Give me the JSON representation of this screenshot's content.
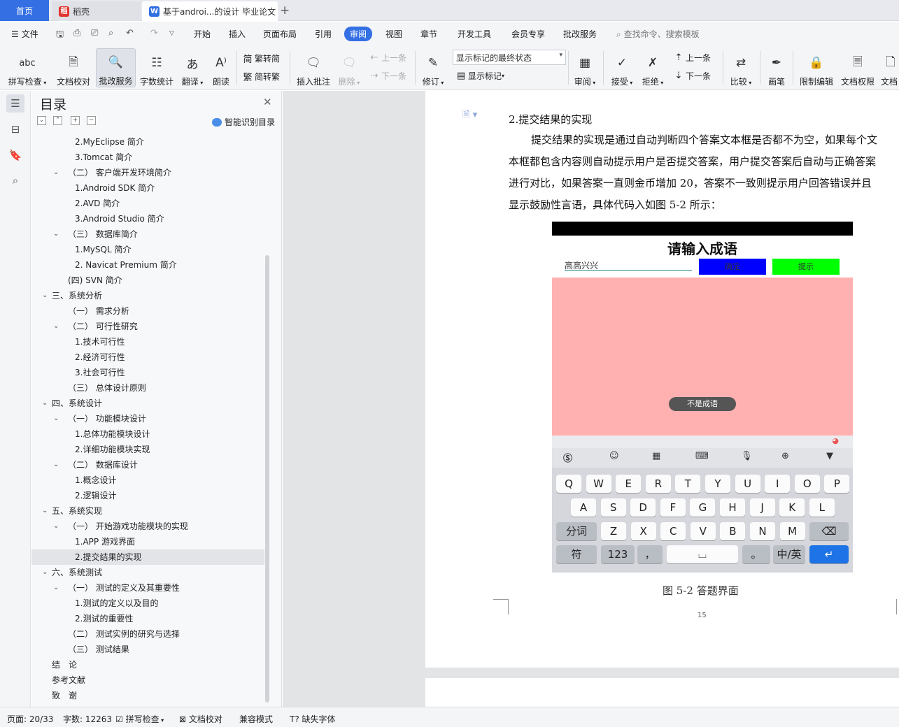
{
  "tabs": {
    "home": "首页",
    "daoke": "稻壳",
    "document": "基于androi...的设计 毕业论文"
  },
  "menu": {
    "file": "文件",
    "items": [
      "开始",
      "插入",
      "页面布局",
      "引用",
      "审阅",
      "视图",
      "章节",
      "开发工具",
      "会员专享",
      "批改服务"
    ],
    "active": "审阅",
    "search_placeholder": "查找命令、搜索模板"
  },
  "ribbon": {
    "spell_check": "拼写检查",
    "doc_check": "文档校对",
    "review_service": "批改服务",
    "word_count": "字数统计",
    "translate": "翻译",
    "read_aloud": "朗读",
    "trad_conv": "繁转简",
    "simp_conv": "简转繁",
    "insert_comment": "插入批注",
    "delete": "删除",
    "prev": "上一条",
    "next": "下一条",
    "track_changes": "修订",
    "markup_state": "显示标记的最终状态",
    "show_markup": "显示标记",
    "review": "审阅",
    "accept": "接受",
    "reject": "拒绝",
    "prev2": "上一条",
    "next2": "下一条",
    "compare": "比较",
    "pen": "画笔",
    "restrict_edit": "限制编辑",
    "doc_permission": "文档权限",
    "doc_more": "文档"
  },
  "toc": {
    "title": "目录",
    "smart": "智能识别目录",
    "items": [
      {
        "label": "2.MyEclipse 简介",
        "level": 3,
        "caret": ""
      },
      {
        "label": "3.Tomcat 简介",
        "level": 3,
        "caret": ""
      },
      {
        "label": "（二） 客户端开发环境简介",
        "level": 2,
        "caret": "down"
      },
      {
        "label": "1.Android SDK 简介",
        "level": 3,
        "caret": ""
      },
      {
        "label": "2.AVD 简介",
        "level": 3,
        "caret": ""
      },
      {
        "label": "3.Android Studio 简介",
        "level": 3,
        "caret": ""
      },
      {
        "label": "（三） 数据库简介",
        "level": 2,
        "caret": "down"
      },
      {
        "label": "1.MySQL 简介",
        "level": 3,
        "caret": ""
      },
      {
        "label": "2. Navicat Premium 简介",
        "level": 3,
        "caret": ""
      },
      {
        "label": "(四) SVN 简介",
        "level": 2,
        "caret": ""
      },
      {
        "label": "三、系统分析",
        "level": 1,
        "caret": "down"
      },
      {
        "label": "（一） 需求分析",
        "level": 2,
        "caret": ""
      },
      {
        "label": "（二） 可行性研究",
        "level": 2,
        "caret": "down"
      },
      {
        "label": "1.技术可行性",
        "level": 3,
        "caret": ""
      },
      {
        "label": "2.经济可行性",
        "level": 3,
        "caret": ""
      },
      {
        "label": "3.社会可行性",
        "level": 3,
        "caret": ""
      },
      {
        "label": "（三） 总体设计原则",
        "level": 2,
        "caret": ""
      },
      {
        "label": "四、系统设计",
        "level": 1,
        "caret": "down"
      },
      {
        "label": "（一） 功能模块设计",
        "level": 2,
        "caret": "down"
      },
      {
        "label": "1.总体功能模块设计",
        "level": 3,
        "caret": ""
      },
      {
        "label": "2.详细功能模块实现",
        "level": 3,
        "caret": ""
      },
      {
        "label": "（二） 数据库设计",
        "level": 2,
        "caret": "down"
      },
      {
        "label": "1.概念设计",
        "level": 3,
        "caret": ""
      },
      {
        "label": "2.逻辑设计",
        "level": 3,
        "caret": ""
      },
      {
        "label": "五、系统实现",
        "level": 1,
        "caret": "down"
      },
      {
        "label": "（一） 开始游戏功能模块的实现",
        "level": 2,
        "caret": "down"
      },
      {
        "label": "1.APP 游戏界面",
        "level": 3,
        "caret": ""
      },
      {
        "label": "2.提交结果的实现",
        "level": 3,
        "caret": "",
        "selected": true
      },
      {
        "label": "六、系统测试",
        "level": 1,
        "caret": "down"
      },
      {
        "label": "（一） 测试的定义及其重要性",
        "level": 2,
        "caret": "down"
      },
      {
        "label": "1.测试的定义以及目的",
        "level": 3,
        "caret": ""
      },
      {
        "label": "2.测试的重要性",
        "level": 3,
        "caret": ""
      },
      {
        "label": "（二） 测试实例的研究与选择",
        "level": 2,
        "caret": ""
      },
      {
        "label": "（三） 测试结果",
        "level": 2,
        "caret": ""
      },
      {
        "label": "结　论",
        "level": 1,
        "caret": ""
      },
      {
        "label": "参考文献",
        "level": 1,
        "caret": ""
      },
      {
        "label": "致　谢",
        "level": 1,
        "caret": ""
      }
    ]
  },
  "doc": {
    "heading": "2.提交结果的实现",
    "lines": [
      "提交结果的实现是通过自动判断四个答案文本框是否都不为空，如果每个文",
      "本框都包含内容则自动提示用户是否提交答案，用户提交答案后自动与正确答案",
      "进行对比，如果答案一直则金币增加 20，答案不一致则提示用户回答错误并且",
      "显示鼓励性言语，具体代码入如图 5-2 所示："
    ],
    "figure_caption": "图 5-2  答题界面",
    "page_number": "15"
  },
  "phone": {
    "title": "请输入成语",
    "input_value": "高高兴兴",
    "confirm_btn": "确定",
    "hint_btn": "提示",
    "toast": "不是成语",
    "keys_row1": [
      "Q",
      "W",
      "E",
      "R",
      "T",
      "Y",
      "U",
      "I",
      "O",
      "P"
    ],
    "keys_row2": [
      "A",
      "S",
      "D",
      "F",
      "G",
      "H",
      "J",
      "K",
      "L"
    ],
    "keys_row3": [
      "Z",
      "X",
      "C",
      "V",
      "B",
      "N",
      "M"
    ],
    "key_fenci": "分词",
    "key_fu": "符",
    "key_123": "123",
    "key_comma": "，",
    "key_period": "。",
    "key_lang": "中/英"
  },
  "status": {
    "page": "页面: 20/33",
    "words": "字数: 12263",
    "spell": "拼写检查",
    "doc_check": "文档校对",
    "compat": "兼容模式",
    "missing_font": "缺失字体"
  },
  "colors": {
    "accent": "#3470e4",
    "phone_area": "#ffb0b0",
    "confirm": "#0000ff",
    "hint": "#00ff00"
  }
}
